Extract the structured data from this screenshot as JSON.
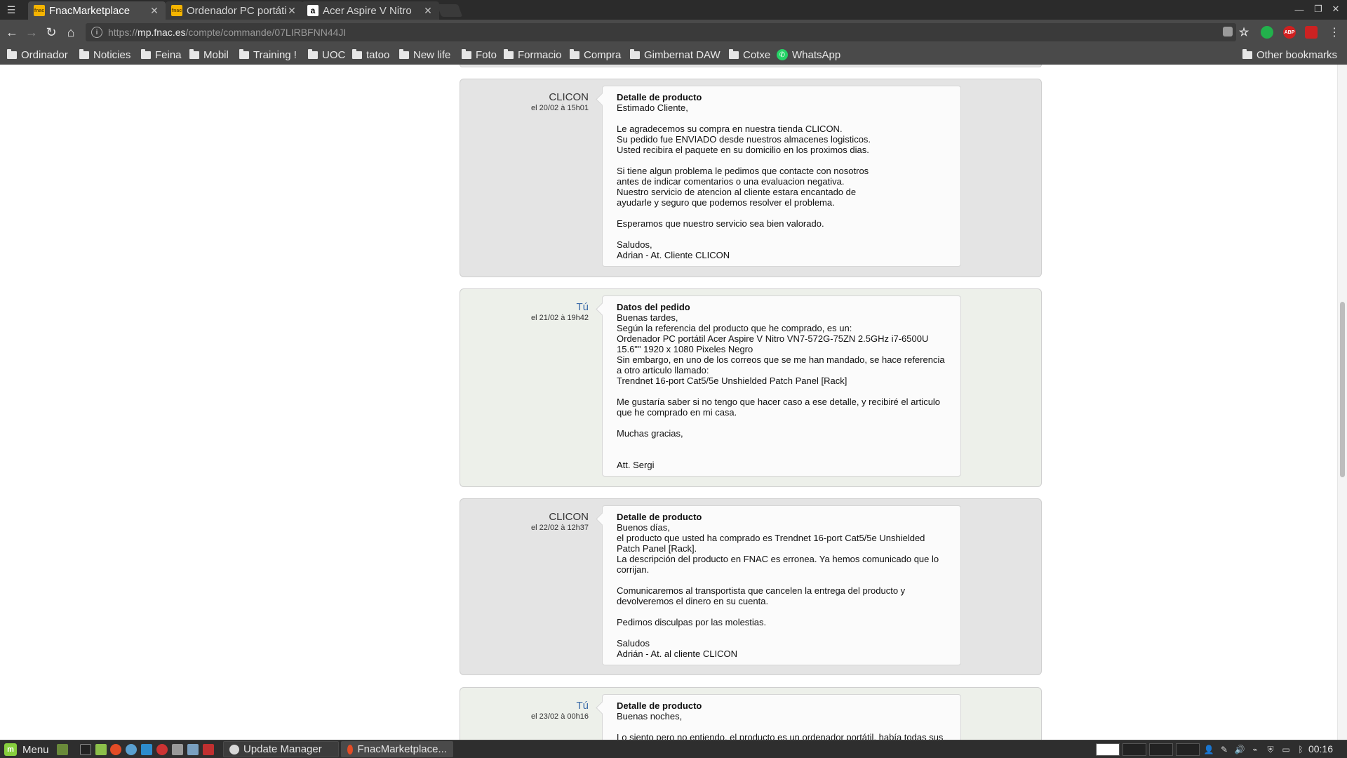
{
  "browser": {
    "tabs": [
      {
        "title": "FnacMarketplace",
        "favicon": "fnac-favicon",
        "active": true
      },
      {
        "title": "Ordenador PC portátil",
        "favicon": "fnac-favicon",
        "active": false
      },
      {
        "title": "Acer Aspire V Nitro",
        "favicon": "amazon-favicon",
        "active": false
      }
    ],
    "url_scheme": "https://",
    "url_host": "mp.fnac.es",
    "url_path": "/compte/commande/07LIRBFNN44JI",
    "bookmarks": [
      "Ordinador",
      "Noticies",
      "Feina",
      "Mobil",
      "Training !",
      "UOC",
      "tatoo",
      "New life",
      "Foto",
      "Formacio",
      "Compra",
      "Gimbernat DAW",
      "Cotxe",
      "WhatsApp"
    ],
    "other_bookmarks": "Other bookmarks",
    "extension_abp": "ABP"
  },
  "messages": [
    {
      "sender": "CLICON",
      "sender_type": "seller",
      "date": "el 20/02 à 15h01",
      "title": "Detalle de producto",
      "lines": [
        "Estimado Cliente,",
        "",
        "Le agradecemos su compra en nuestra tienda CLICON.",
        "Su pedido fue ENVIADO desde nuestros almacenes logisticos.",
        "Usted recibira el paquete en su domicilio en los proximos dias.",
        "",
        "Si tiene algun problema le pedimos que contacte con nosotros",
        "antes de indicar comentarios o una evaluacion negativa.",
        "Nuestro servicio de atencion al cliente estara encantado de",
        "ayudarle y seguro que podemos resolver el problema.",
        "",
        "Esperamos que nuestro servicio sea bien valorado.",
        "",
        "Saludos,",
        "Adrian - At. Cliente CLICON"
      ]
    },
    {
      "sender": "Tú",
      "sender_type": "buyer",
      "date": "el 21/02 à 19h42",
      "title": "Datos del pedido",
      "lines": [
        "Buenas tardes,",
        "Según la referencia del producto que he comprado, es un:",
        "Ordenador PC portátil Acer Aspire V Nitro VN7-572G-75ZN 2.5GHz i7-6500U",
        "15.6\"\" 1920 x 1080 Pixeles Negro",
        "Sin embargo, en uno de los correos que se me han mandado, se hace referencia",
        "a otro articulo llamado:",
        "Trendnet 16-port Cat5/5e Unshielded Patch Panel [Rack]",
        "",
        "Me gustaría saber si no tengo que hacer caso a ese detalle, y recibiré el articulo",
        "que he comprado en mi casa.",
        "",
        "Muchas gracias,",
        "",
        "",
        "Att. Sergi"
      ]
    },
    {
      "sender": "CLICON",
      "sender_type": "seller",
      "date": "el 22/02 à 12h37",
      "title": "Detalle de producto",
      "lines": [
        "Buenos días,",
        "el producto que usted ha comprado es Trendnet 16-port Cat5/5e Unshielded",
        "Patch Panel [Rack].",
        "La descripción del producto en FNAC es erronea. Ya hemos comunicado que lo",
        "corrijan.",
        "",
        "Comunicaremos al transportista que cancelen la entrega del producto y",
        "devolveremos el dinero en su cuenta.",
        "",
        "Pedimos disculpas por las molestias.",
        "",
        "Saludos",
        "Adrián - At. al cliente CLICON"
      ]
    },
    {
      "sender": "Tú",
      "sender_type": "buyer",
      "date": "el 23/02 à 00h16",
      "title": "Detalle de producto",
      "lines": [
        "Buenas noches,",
        "",
        "Lo siento pero no entiendo, el producto es un ordenador portátil, había todas sus"
      ]
    }
  ],
  "taskbar": {
    "menu_label": "Menu",
    "windows": [
      "Update Manager",
      "FnacMarketplace..."
    ],
    "clock": "00:16"
  },
  "colors": {
    "seller_bg": "#e4e4e4",
    "buyer_bg": "#edf0ea",
    "buyer_name": "#3a6aa8"
  }
}
